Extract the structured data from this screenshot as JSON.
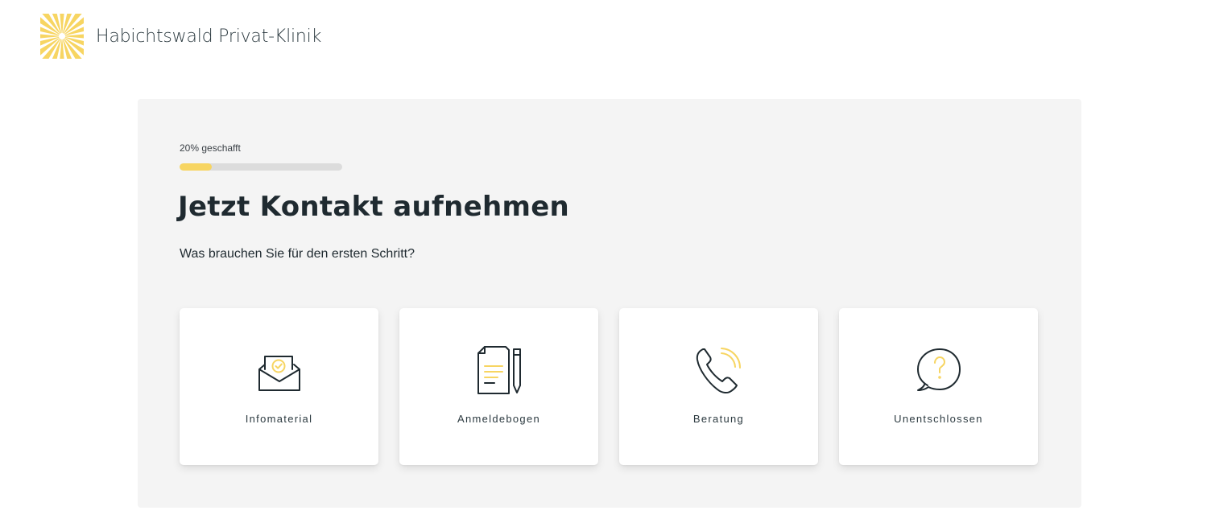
{
  "brand": {
    "name": "Habichtswald Privat-Klinik",
    "logo_icon": "sunburst-logo-icon",
    "accent_color": "#f7d562"
  },
  "progress": {
    "label": "20% geschafft",
    "fraction": 0.2
  },
  "form": {
    "headline": "Jetzt Kontakt aufnehmen",
    "question": "Was brauchen Sie für den ersten Schritt?",
    "options": [
      {
        "label": "Infomaterial",
        "icon": "envelope-check-icon"
      },
      {
        "label": "Anmeldebogen",
        "icon": "document-pen-icon"
      },
      {
        "label": "Beratung",
        "icon": "phone-call-icon"
      },
      {
        "label": "Unentschlossen",
        "icon": "question-bubble-icon"
      }
    ]
  }
}
